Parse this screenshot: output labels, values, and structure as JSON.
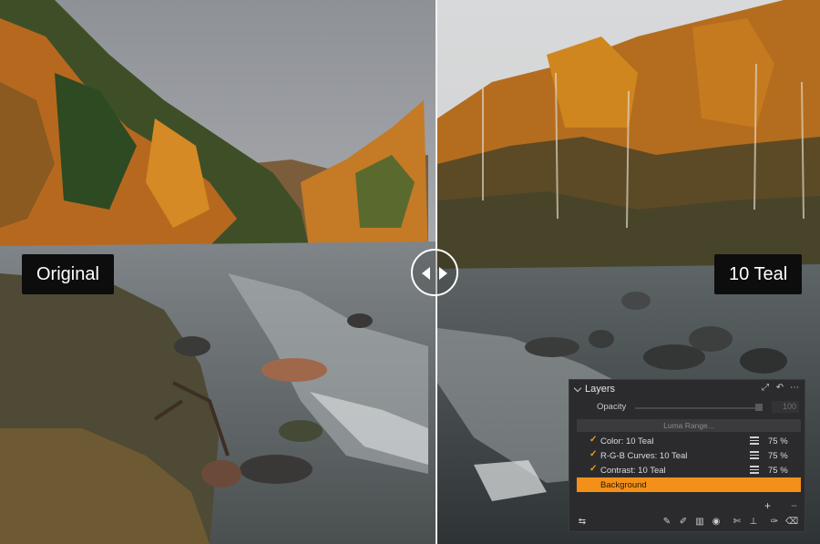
{
  "comparison": {
    "left_label": "Original",
    "right_label": "10 Teal"
  },
  "layers_panel": {
    "title": "Layers",
    "opacity": {
      "label": "Opacity",
      "value": "100"
    },
    "luma_range_label": "Luma Range...",
    "layers": [
      {
        "name": "Color: 10 Teal",
        "checked": true,
        "opacity": "75 %"
      },
      {
        "name": "R-G-B Curves: 10 Teal",
        "checked": true,
        "opacity": "75 %"
      },
      {
        "name": "Contrast: 10 Teal",
        "checked": true,
        "opacity": "75 %"
      },
      {
        "name": "Background",
        "selected": true
      }
    ],
    "footer": {
      "add_label": "+",
      "remove_label": "−"
    },
    "tools": [
      "brush-icon",
      "gradient-brush-icon",
      "linear-gradient-icon",
      "radial-gradient-icon",
      "eraser-icon",
      "stamp-icon",
      "pen-icon",
      "clear-icon"
    ]
  },
  "colors": {
    "accent": "#f39019",
    "panel_bg": "#2b2b2d",
    "check": "#f39c1a"
  }
}
